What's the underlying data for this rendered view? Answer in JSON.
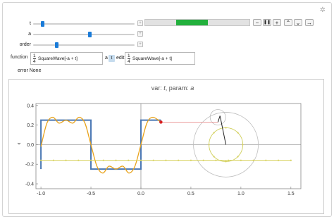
{
  "controls": {
    "t_label": "t",
    "a_label": "a",
    "order_label": "order",
    "t_value": 0.08,
    "a_value": 0.56,
    "order_value": 0.22,
    "progress_value": 0.6
  },
  "buttons": {
    "minus": "−",
    "pause": "❚❚",
    "plus": "+",
    "faster": "⌃",
    "slower": "⌄",
    "direction": "→"
  },
  "inputs": {
    "function_label": "function",
    "function_num": "1",
    "function_den": "4",
    "function_expr": "SquareWave[-a + t]",
    "a_label": "a",
    "t_button": "t",
    "edit_label": "edit:",
    "edit_num": "1",
    "edit_den": "4",
    "edit_expr": "SquareWave[-a + t]"
  },
  "error_text": "error None",
  "plot": {
    "title_prefix": "var: ",
    "title_var": "t",
    "title_mid": ", param: ",
    "title_param": "a",
    "side_label": "⌄",
    "x_ticks": [
      "-1.0",
      "-0.5",
      "0.0",
      "0.5",
      "1.0",
      "1.5"
    ],
    "y_ticks": [
      "0.4",
      "0.2",
      "0.0",
      "-0.2",
      "-0.4"
    ],
    "square_color": "#4a77b4",
    "fourier_color": "#e8a21b",
    "point_color": "#d92020",
    "dotted_color": "#d6d05a"
  },
  "chart_data": {
    "type": "line",
    "title": "var: t, param: a",
    "xlabel": "",
    "ylabel": "",
    "xlim": [
      -1.05,
      1.6
    ],
    "ylim": [
      -0.45,
      0.42
    ],
    "current_x": 0.2,
    "series": [
      {
        "x": [
          -1.0,
          -1.0,
          -0.5,
          -0.5,
          0.0,
          0.0,
          0.2
        ],
        "values": [
          -0.25,
          0.25,
          0.25,
          -0.25,
          -0.25,
          0.25,
          0.25
        ]
      },
      {
        "x": [
          -1.0,
          -0.94,
          -0.88,
          -0.82,
          -0.75,
          -0.68,
          -0.62,
          -0.56,
          -0.5,
          -0.44,
          -0.38,
          -0.32,
          -0.25,
          -0.18,
          -0.12,
          -0.06,
          0.0,
          0.06,
          0.12,
          0.2
        ],
        "values": [
          -0.02,
          0.22,
          0.28,
          0.22,
          0.25,
          0.22,
          0.28,
          0.22,
          0.0,
          -0.22,
          -0.29,
          -0.22,
          -0.25,
          -0.22,
          -0.29,
          -0.22,
          0.0,
          0.22,
          0.28,
          0.23
        ]
      },
      {
        "x": [
          -1.0,
          -0.875,
          -0.75,
          -0.625,
          -0.5,
          -0.375,
          -0.25,
          -0.125,
          0.0,
          0.125,
          0.25,
          0.375,
          0.5,
          0.625,
          0.75,
          0.875,
          1.0,
          1.125,
          1.25,
          1.375,
          1.5
        ],
        "values": [
          -0.16,
          -0.16,
          -0.16,
          -0.16,
          -0.16,
          -0.16,
          -0.16,
          -0.16,
          -0.16,
          -0.16,
          -0.16,
          -0.16,
          -0.16,
          -0.16,
          -0.16,
          -0.16,
          -0.16,
          -0.16,
          -0.16,
          -0.16,
          -0.16
        ]
      }
    ]
  }
}
